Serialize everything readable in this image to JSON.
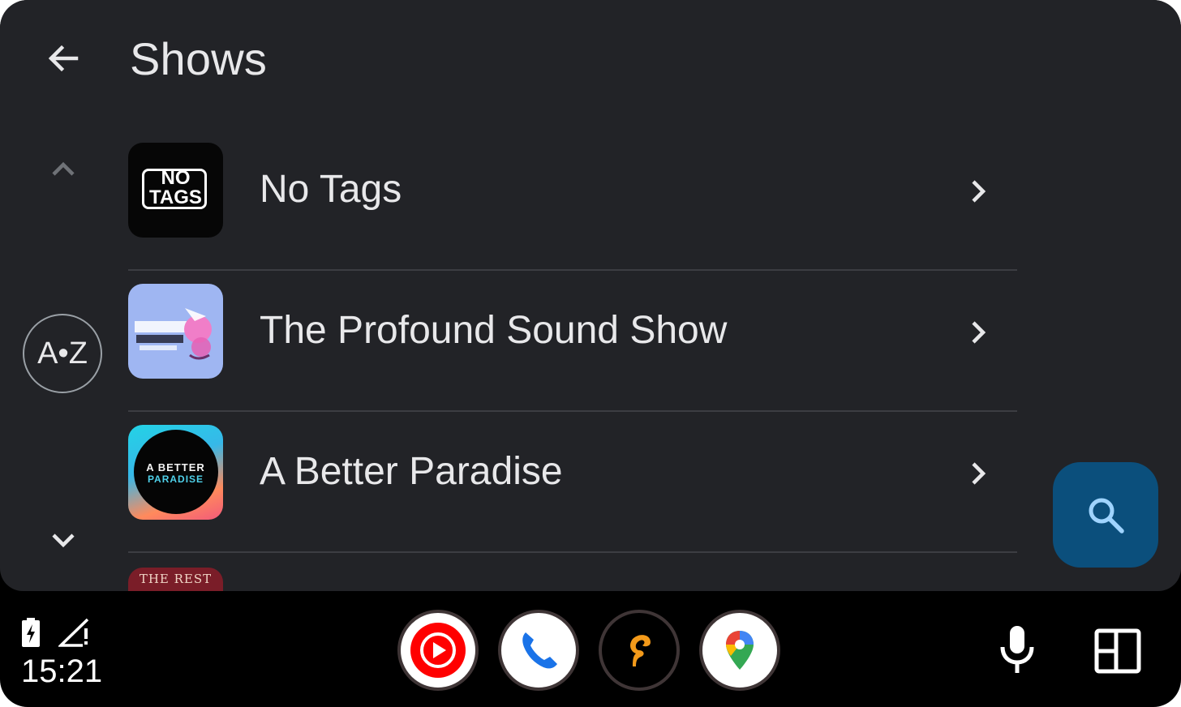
{
  "header": {
    "back_icon": "arrow-back-icon",
    "title": "Shows"
  },
  "side_controls": {
    "scroll_up_icon": "chevron-up-icon",
    "az_label": "A•Z",
    "scroll_down_icon": "chevron-down-icon"
  },
  "shows": [
    {
      "title": "No Tags",
      "artwork_text_top": "NO",
      "artwork_text_bottom": "TAGS",
      "chevron_icon": "chevron-right-icon"
    },
    {
      "title": "The Profound Sound Show",
      "chevron_icon": "chevron-right-icon"
    },
    {
      "title": "A Better Paradise",
      "artwork_text_top": "A BETTER",
      "artwork_text_bottom": "PARADISE",
      "chevron_icon": "chevron-right-icon"
    }
  ],
  "partial_row": {
    "artwork_text": "THE REST"
  },
  "search": {
    "icon": "search-icon"
  },
  "status_bar": {
    "battery_icon": "battery-charging-icon",
    "signal_icon": "signal-no-data-icon",
    "time": "15:21"
  },
  "dock": {
    "apps": [
      {
        "name": "YouTube Music",
        "icon": "youtube-music-icon"
      },
      {
        "name": "Phone",
        "icon": "phone-icon"
      },
      {
        "name": "Podcast app",
        "icon": "podcast-app-icon"
      },
      {
        "name": "Google Maps",
        "icon": "maps-icon"
      }
    ],
    "mic_icon": "microphone-icon",
    "layout_icon": "dashboard-layout-icon"
  },
  "colors": {
    "background": "#222327",
    "bottom_bar": "#000000",
    "search_fab": "#0b4f7c",
    "divider": "#3c3d42",
    "text": "#e8e8ea"
  }
}
